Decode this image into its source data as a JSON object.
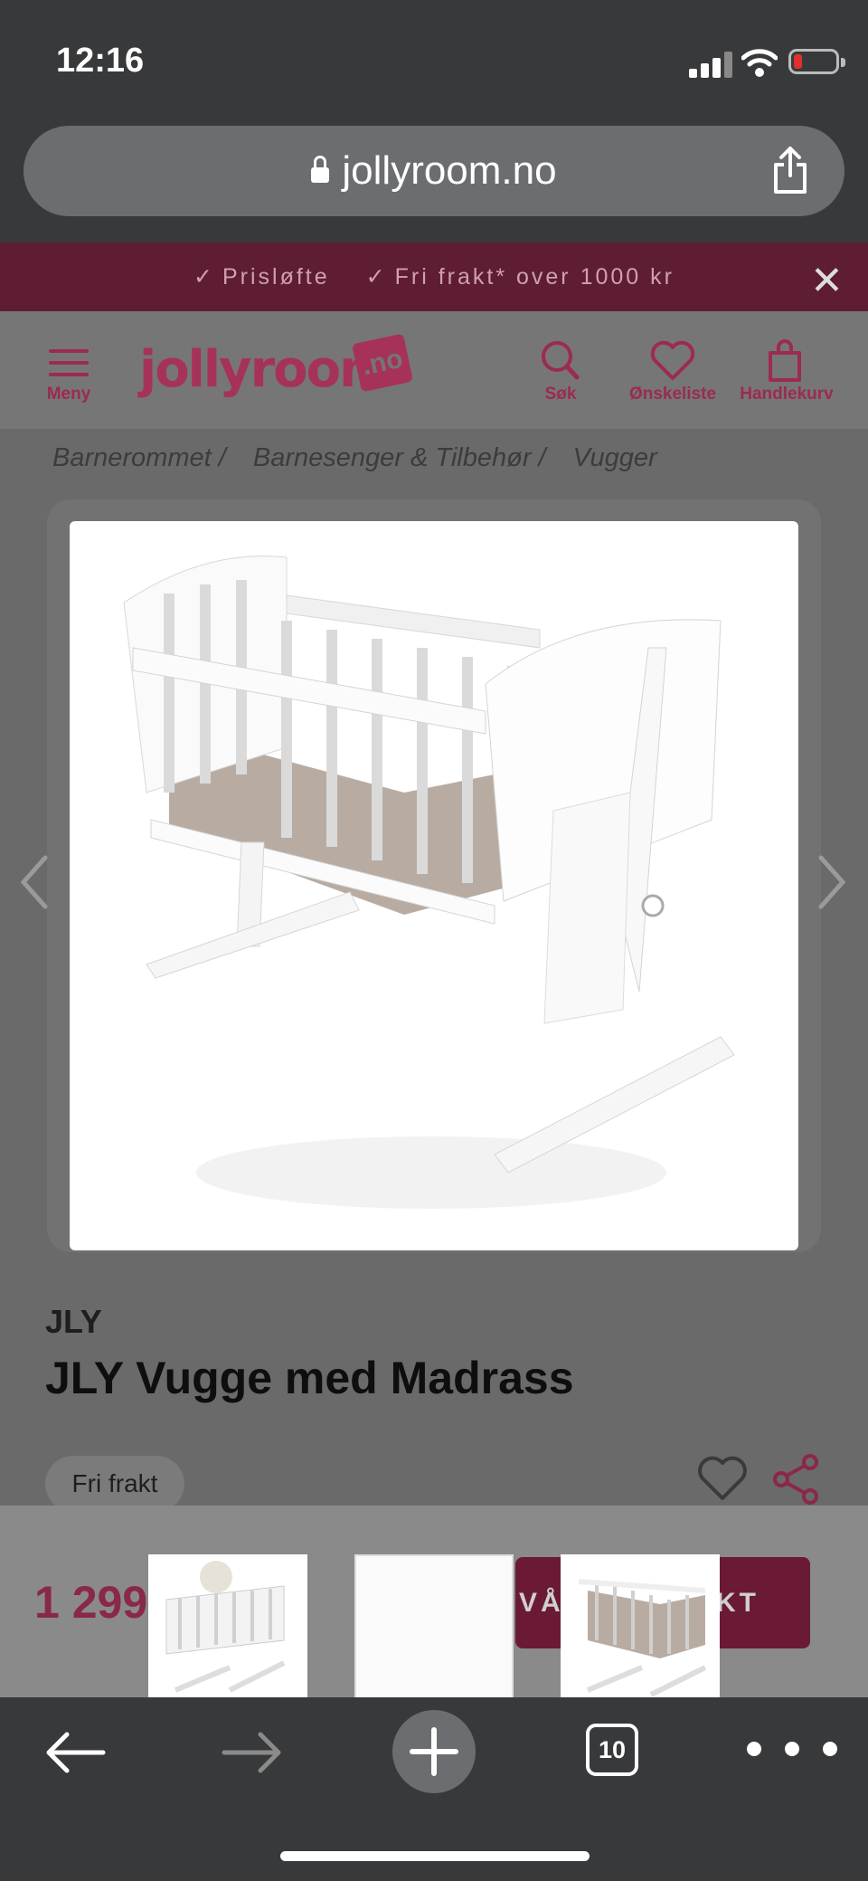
{
  "status_bar": {
    "time": "12:16"
  },
  "browser": {
    "url": "jollyroom.no",
    "tab_count": "10"
  },
  "promo": {
    "items": [
      "Prisløfte",
      "Fri frakt* over 1000 kr"
    ],
    "checkmark": "✓",
    "close": "✕"
  },
  "header": {
    "menu_label": "Meny",
    "logo_text": "jollyroom",
    "logo_suffix": ".no",
    "search_label": "Søk",
    "wishlist_label": "Ønskeliste",
    "cart_label": "Handlekurv"
  },
  "breadcrumb": [
    "Barnerommet /",
    "Barnesenger & Tilbehør /",
    "Vugger"
  ],
  "product": {
    "brand": "JLY",
    "title": "JLY Vugge med Madrass",
    "shipping_chip": "Fri frakt",
    "price": "1 299",
    "buy_button_left": "VÅ",
    "buy_button_right": "KT"
  },
  "icons": {
    "accent": "#9c2b4f",
    "lock": "lock-icon",
    "share": "share-icon",
    "back": "back-arrow-icon",
    "forward": "forward-arrow-icon",
    "new_tab": "plus-icon",
    "more": "more-icon"
  }
}
